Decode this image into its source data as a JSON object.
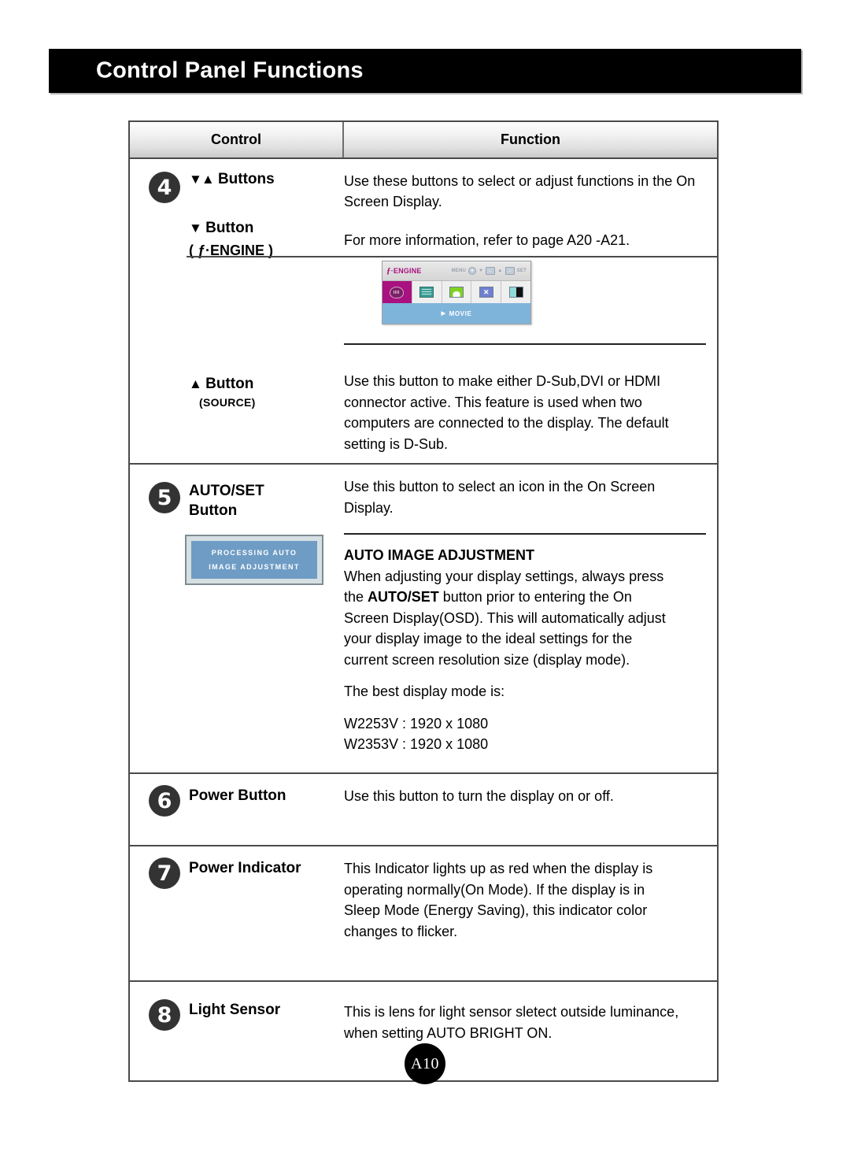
{
  "page": {
    "title": "Control Panel Functions",
    "page_number": "A10"
  },
  "table": {
    "headers": {
      "control": "Control",
      "function": "Function"
    },
    "rows": [
      {
        "number": "4",
        "control_label_arrows": "▼▲",
        "control_label": "Buttons",
        "function_lines": [
          "Use these buttons to select or adjust functions in the On",
          "Screen Display."
        ],
        "sub": {
          "control_label_arrows": "▼",
          "control_label": "Button",
          "control_sub_label": "( ƒ·ENGINE )",
          "function_lines": [
            "For more information, refer to page A20 -A21."
          ]
        },
        "sub2": {
          "control_label_arrows": "▲",
          "control_label": "Button",
          "control_sub_label": "(SOURCE)",
          "function_lines": [
            "Use this button to make either D-Sub,DVI or HDMI",
            "connector active. This feature is used when two",
            "computers are connected to the display. The default",
            "setting is D-Sub."
          ]
        }
      },
      {
        "number": "5",
        "control_label": "AUTO/SET",
        "control_label2": "Button",
        "function_lines": [
          "Use this button to select an icon in the On Screen",
          "Display."
        ],
        "section_heading": "AUTO IMAGE ADJUSTMENT",
        "section_lines": [
          "When adjusting your display settings, always press",
          "the AUTO/SET button prior to entering the On",
          "Screen Display(OSD). This will automatically adjust",
          "your display image to the ideal settings for the",
          "current screen resolution size (display mode)."
        ],
        "best_mode_label": "The best display mode is:",
        "modes": [
          "W2253V : 1920 x 1080",
          "W2353V : 1920 x 1080"
        ]
      },
      {
        "number": "6",
        "control_label": "Power Button",
        "function_lines": [
          "Use this button to turn the display on or off."
        ]
      },
      {
        "number": "7",
        "control_label": "Power Indicator",
        "function_lines": [
          "This Indicator lights up as red when the display is",
          "operating normally(On Mode). If the display is in",
          "Sleep Mode (Energy Saving), this indicator color",
          "changes to flicker."
        ]
      },
      {
        "number": "8",
        "control_label": "Light Sensor",
        "function_lines": [
          "This is lens for light sensor sletect outside luminance,",
          "when setting AUTO BRIGHT ON."
        ]
      }
    ]
  },
  "osd_graphic": {
    "brand_f": "ƒ",
    "brand_text": "·ENGINE",
    "menu_label": "MENU",
    "down_label": "▼",
    "up_label": "▲",
    "set_label": "SET",
    "selected_mode": "MOVIE",
    "caret": "▶"
  },
  "processing_graphic": {
    "line1": "PROCESSING AUTO",
    "line2": "IMAGE ADJUSTMENT"
  },
  "colors": {
    "osd_accent": "#a8117f",
    "osd_bottom": "#7fb4da",
    "processing_fill": "#6e9cc4",
    "badge": "#333333"
  }
}
